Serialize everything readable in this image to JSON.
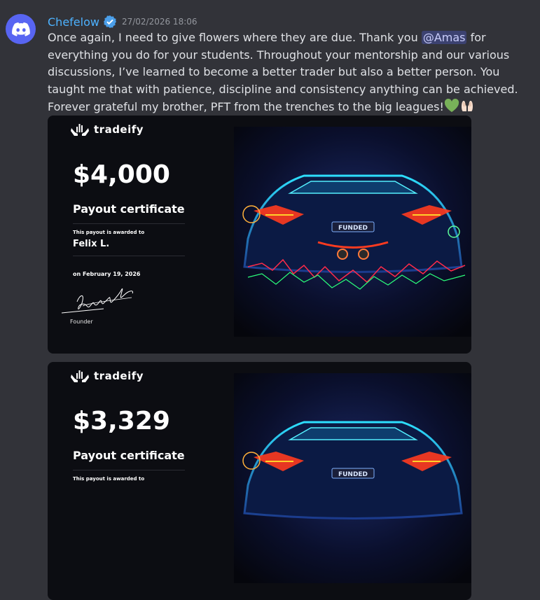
{
  "message": {
    "author": "Chefelow",
    "timestamp": "27/02/2026 18:06",
    "text_before": "Once again, I need to give flowers where they are due. Thank you ",
    "mention": "@Amas",
    "text_after": " for everything you do for your students. Throughout your mentorship and our various discussions, I’ve learned to become a better trader but also a better person. You taught me that with patience, discipline and consistency anything can be achieved. Forever grateful my brother, PFT from the trenches to the big leagues!",
    "emojis": [
      "green-heart",
      "raised-hands"
    ]
  },
  "attachments": [
    {
      "brand": "tradeify",
      "amount": "$4,000",
      "title": "Payout certificate",
      "awarded_label": "This payout is awarded to",
      "recipient": "Felix L.",
      "date": "on February 19, 2026",
      "signature": "Brett Simberkoff",
      "founder_label": "Founder",
      "plate": "FUNDED"
    },
    {
      "brand": "tradeify",
      "amount": "$3,329",
      "title": "Payout certificate",
      "awarded_label": "This payout is awarded to",
      "plate": "FUNDED"
    }
  ],
  "colors": {
    "background": "#323339",
    "username": "#4db2ff",
    "mention_bg": "#3c4270",
    "discord_blurple": "#5865f2"
  }
}
